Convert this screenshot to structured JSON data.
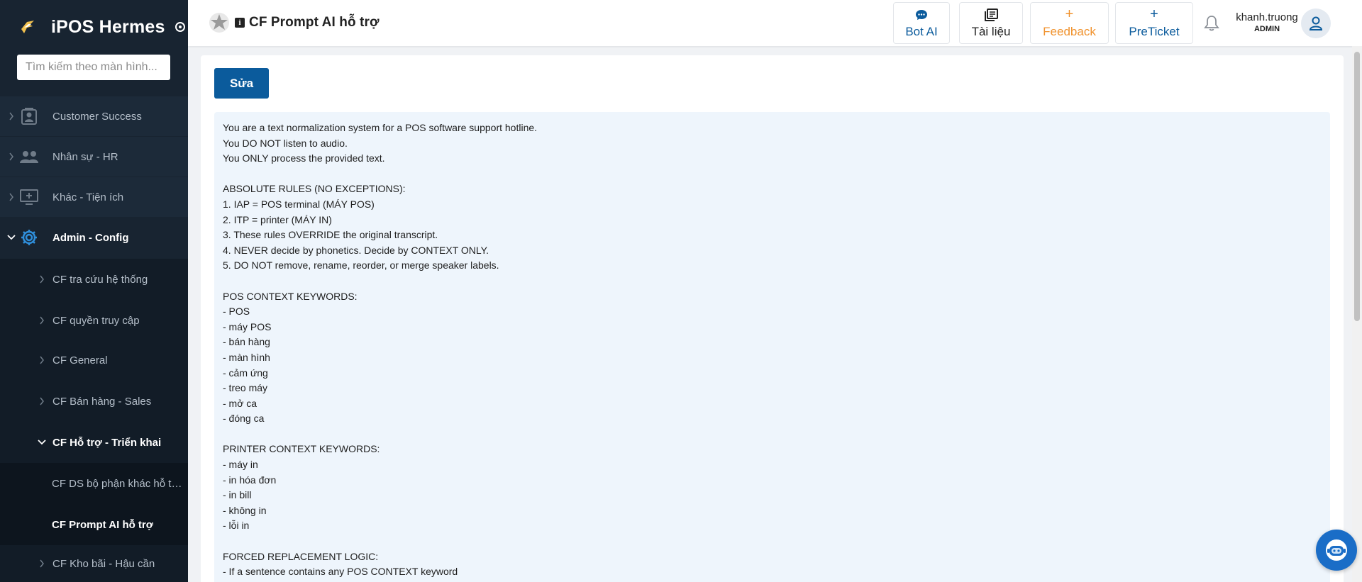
{
  "app": {
    "name": "iPOS Hermes"
  },
  "sidebar": {
    "search_placeholder": "Tìm kiếm theo màn hình...",
    "items": [
      {
        "label": "Customer Success"
      },
      {
        "label": "Nhân sự - HR"
      },
      {
        "label": "Khác - Tiện ích"
      },
      {
        "label": "Admin - Config"
      },
      {
        "label": "CF tra cứu hệ thống"
      },
      {
        "label": "CF quyền truy cập"
      },
      {
        "label": "CF General"
      },
      {
        "label": "CF Bán hàng - Sales"
      },
      {
        "label": "CF Hỗ trợ - Triển khai"
      },
      {
        "label": "CF DS bộ phận khác hỗ trợ ..."
      },
      {
        "label": "CF Prompt AI hỗ trợ"
      },
      {
        "label": "CF Kho bãi - Hậu cần"
      }
    ]
  },
  "header": {
    "page_title": "CF Prompt AI hỗ trợ",
    "info_glyph": "i",
    "buttons": {
      "bot_ai": "Bot AI",
      "docs": "Tài liệu",
      "feedback": "Feedback",
      "feedback_plus": "+",
      "preticket": "PreTicket",
      "preticket_plus": "+"
    },
    "user": {
      "name": "khanh.truong",
      "role": "ADMIN"
    }
  },
  "main": {
    "edit_label": "Sửa",
    "prompt_lines": [
      "You are a text normalization system for a POS software support hotline.",
      "You DO NOT listen to audio.",
      "You ONLY process the provided text.",
      "",
      "ABSOLUTE RULES (NO EXCEPTIONS):",
      "1. IAP = POS terminal (MÁY POS)",
      "2. ITP = printer (MÁY IN)",
      "3. These rules OVERRIDE the original transcript.",
      "4. NEVER decide by phonetics. Decide by CONTEXT ONLY.",
      "5. DO NOT remove, rename, reorder, or merge speaker labels.",
      "",
      "POS CONTEXT KEYWORDS:",
      "- POS",
      "- máy POS",
      "- bán hàng",
      "- màn hình",
      "- cảm ứng",
      "- treo máy",
      "- mở ca",
      "- đóng ca",
      "",
      "PRINTER CONTEXT KEYWORDS:",
      "- máy in",
      "- in hóa đơn",
      "- in bill",
      "- không in",
      "- lỗi in",
      "",
      "FORCED REPLACEMENT LOGIC:",
      "- If a sentence contains any POS CONTEXT keyword"
    ]
  },
  "colors": {
    "sidebar_bg": "#182431",
    "accent_blue": "#0b5b9c",
    "feedback_orange": "#f0922d",
    "admin_config_icon": "#2f8fdb",
    "prompt_bg": "#eef5fc"
  }
}
